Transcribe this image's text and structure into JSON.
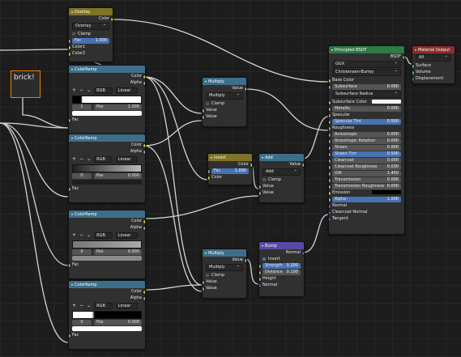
{
  "frame": {
    "label": "brick!"
  },
  "overlay": {
    "title": "Overlay",
    "out_color": "Color",
    "blend": "Overlay",
    "clamp": "Clamp",
    "fac_label": "Fac",
    "fac_value": "1.000",
    "in_color1": "Color1",
    "in_color2": "Color2"
  },
  "ramp_common": {
    "title": "ColorRamp",
    "out_color": "Color",
    "out_alpha": "Alpha",
    "mode": "RGB",
    "interp": "Linear",
    "pos_label": "Pos",
    "fac": "Fac",
    "plus": "+",
    "minus": "−",
    "chev": "⌄"
  },
  "ramp1": {
    "index": "1",
    "pos": "1.000"
  },
  "ramp2": {
    "index": "0",
    "pos": "0.000"
  },
  "ramp3": {
    "index": "0",
    "pos": "0.000"
  },
  "ramp4": {
    "index": "0",
    "pos": "0.000"
  },
  "multiply1": {
    "title": "Multiply",
    "out_value": "Value",
    "op": "Multiply",
    "clamp": "Clamp",
    "in1": "Value",
    "in2": "Value"
  },
  "multiply2": {
    "title": "Multiply",
    "out_value": "Value",
    "op": "Multiply",
    "clamp": "Clamp",
    "in1": "Value",
    "in2": "Value"
  },
  "invert": {
    "title": "Invert",
    "out_color": "Color",
    "fac_label": "Fac",
    "fac_value": "1.000",
    "in_color": "Color"
  },
  "add": {
    "title": "Add",
    "out_value": "Value",
    "op": "Add",
    "clamp": "Clamp",
    "in1": "Value",
    "in2": "Value"
  },
  "bump": {
    "title": "Bump",
    "out_normal": "Normal",
    "invert": "Invert",
    "strength_label": "Strength",
    "strength_value": "0.200",
    "distance_label": "Distance",
    "distance_value": "0.100",
    "in_height": "Height",
    "in_normal": "Normal"
  },
  "bsdf": {
    "title": "Principled BSDF",
    "out": "BSDF",
    "distribution": "GGX",
    "subsurface_method": "Christensen-Burley",
    "base_color": "Base Color",
    "subsurface_label": "Subsurface",
    "subsurface_value": "0.000",
    "subsurface_radius": "Subsurface Radius",
    "subsurface_color": "Subsurface Color",
    "metallic_label": "Metallic",
    "metallic_value": "0.000",
    "specular": "Specular",
    "specular_tint_label": "Specular Tint",
    "specular_tint_value": "0.500",
    "roughness": "Roughness",
    "anisotropic_label": "Anisotropic",
    "anisotropic_value": "0.000",
    "aniso_rot_label": "Anisotropic Rotation",
    "aniso_rot_value": "0.000",
    "sheen_label": "Sheen",
    "sheen_value": "0.000",
    "sheen_tint_label": "Sheen Tint",
    "sheen_tint_value": "0.500",
    "clearcoat_label": "Clearcoat",
    "clearcoat_value": "0.000",
    "clearcoat_rough_label": "Clearcoat Roughness",
    "clearcoat_rough_value": "0.030",
    "ior_label": "IOR",
    "ior_value": "1.450",
    "transmission_label": "Transmission",
    "transmission_value": "0.000",
    "trans_rough_label": "Transmission Roughness",
    "trans_rough_value": "0.000",
    "emission": "Emission",
    "alpha_label": "Alpha",
    "alpha_value": "1.000",
    "normal": "Normal",
    "clearcoat_normal": "Clearcoat Normal",
    "tangent": "Tangent"
  },
  "output": {
    "title": "Material Output",
    "target": "All",
    "surface": "Surface",
    "volume": "Volume",
    "displacement": "Displacement"
  },
  "colors": {
    "accent": "#4772b3",
    "wire": "#cfcfcf",
    "selected": "#e98000"
  }
}
